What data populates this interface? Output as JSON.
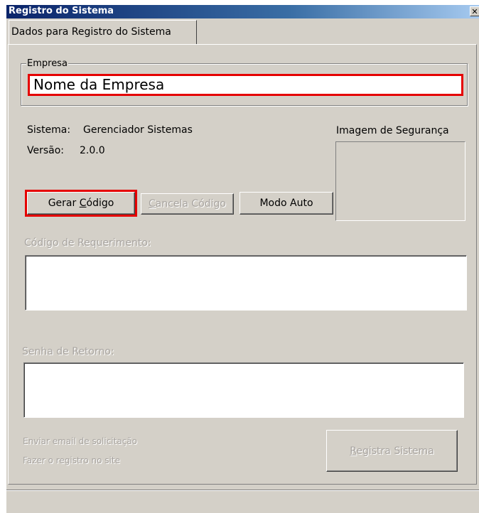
{
  "window": {
    "title": "Registro do Sistema",
    "close_glyph": "✕"
  },
  "tab": {
    "label": "Dados para Registro do Sistema"
  },
  "empresa": {
    "group_label": "Empresa",
    "value": "Nome da Empresa"
  },
  "info": {
    "sistema_label": "Sistema:",
    "sistema_value": "Gerenciador Sistemas",
    "versao_label": "Versão:",
    "versao_value": "2.0.0",
    "imagem_label": "Imagem de Segurança"
  },
  "buttons": {
    "gerar_pre": "Gerar ",
    "gerar_ul": "C",
    "gerar_post": "ódigo",
    "cancela_pre": "",
    "cancela_ul": "C",
    "cancela_post": "ancela Código",
    "modo_auto": "Modo Auto",
    "registra_pre": "",
    "registra_ul": "R",
    "registra_post": "egistra Sistema"
  },
  "fields": {
    "codigo_label": "Código de Requerimento:",
    "codigo_value": "",
    "senha_label": "Senha de Retorno:",
    "senha_value": ""
  },
  "links": {
    "email": "Enviar email de solicitação",
    "site": "Fazer o registro no site"
  },
  "colors": {
    "highlight": "#e50000",
    "face": "#d4d0c8",
    "title_bg": "#0a246a"
  }
}
